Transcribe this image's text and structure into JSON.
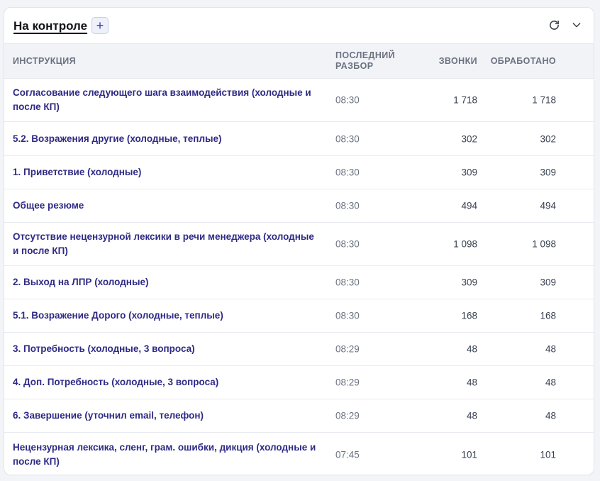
{
  "widget": {
    "title": "На контроле",
    "add_label": "+",
    "refresh_icon": "refresh-icon",
    "collapse_icon": "chevron-down-icon"
  },
  "table": {
    "columns": {
      "instruction": "ИНСТРУКЦИЯ",
      "last_review": "ПОСЛЕДНИЙ РАЗБОР",
      "calls": "ЗВОНКИ",
      "processed": "ОБРАБОТАНО"
    },
    "rows": [
      {
        "name": "Согласование следующего шага взаимодействия (холодные и после КП)",
        "time": "08:30",
        "calls": "1 718",
        "processed": "1 718"
      },
      {
        "name": "5.2. Возражения другие (холодные, теплые)",
        "time": "08:30",
        "calls": "302",
        "processed": "302"
      },
      {
        "name": "1. Приветствие (холодные)",
        "time": "08:30",
        "calls": "309",
        "processed": "309"
      },
      {
        "name": "Общее резюме",
        "time": "08:30",
        "calls": "494",
        "processed": "494"
      },
      {
        "name": "Отсутствие нецензурной лексики в речи менеджера (холодные и после КП)",
        "time": "08:30",
        "calls": "1 098",
        "processed": "1 098"
      },
      {
        "name": "2. Выход на ЛПР (холодные)",
        "time": "08:30",
        "calls": "309",
        "processed": "309"
      },
      {
        "name": "5.1. Возражение Дорого (холодные, теплые)",
        "time": "08:30",
        "calls": "168",
        "processed": "168"
      },
      {
        "name": "3. Потребность (холодные, 3 вопроса)",
        "time": "08:29",
        "calls": "48",
        "processed": "48"
      },
      {
        "name": "4. Доп. Потребность (холодные, 3 вопроса)",
        "time": "08:29",
        "calls": "48",
        "processed": "48"
      },
      {
        "name": "6. Завершение (уточнил email, телефон)",
        "time": "08:29",
        "calls": "48",
        "processed": "48"
      },
      {
        "name": "Нецензурная лексика, сленг, грам. ошибки, дикция (холодные и после КП)",
        "time": "07:45",
        "calls": "101",
        "processed": "101"
      }
    ]
  },
  "colors": {
    "link": "#2e2a85",
    "header_bg": "#f1f3f7",
    "accent_button_bg": "#eef0fb"
  }
}
